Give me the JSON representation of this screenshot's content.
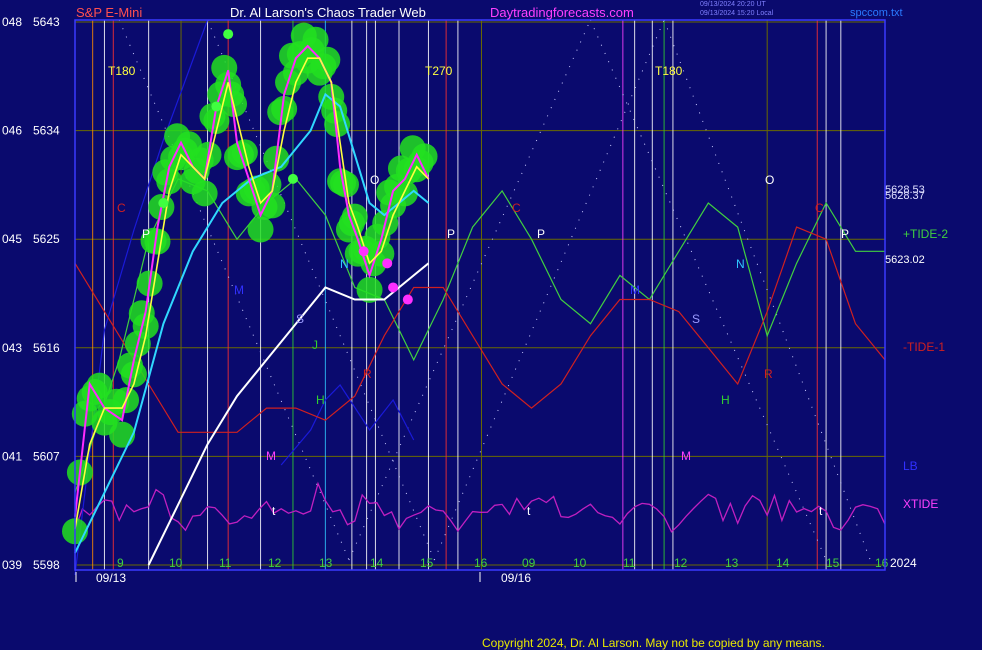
{
  "header": {
    "symbol": "S&P E-Mini",
    "site_title": "Dr. Al Larson's Chaos Trader Web",
    "site_url": "Daytradingforecasts.com",
    "stamp_line1": "09/13/2024 20:20 UT",
    "stamp_line2": "09/13/2024 15:20 Local",
    "file_name": "spccom.txt"
  },
  "footer": {
    "copyright": "Copyright 2024, Dr. Al Larson. May not be copied by any means."
  },
  "colors": {
    "background": "#0a0a6e",
    "grid": "#6a6a00",
    "frame": "#3a3aff",
    "price": "#ff2bff",
    "ema_fast": "#ffff40",
    "ema_mid": "#30d8ff",
    "ema_slow": "#ffffff",
    "halo": "#22e020",
    "tide_pos": "#40d040",
    "tide_neg": "#d02020",
    "lb": "#1a1ad8",
    "xtide": "#c020c0",
    "header_symbol": "#ff5050",
    "header_title": "#ffffff",
    "header_url": "#ff40ff"
  },
  "chart_data": {
    "type": "line",
    "title": "S&P E-Mini",
    "y_axis": {
      "ticks": [
        {
          "code": "039",
          "price": "5598"
        },
        {
          "code": "041",
          "price": "5607"
        },
        {
          "code": "043",
          "price": "5616"
        },
        {
          "code": "045",
          "price": "5625"
        },
        {
          "code": "046",
          "price": "5634"
        },
        {
          "code": "048",
          "price": "5643"
        }
      ],
      "ylim": [
        5598,
        5643
      ]
    },
    "x_axis": {
      "hour_ticks": [
        "9",
        "10",
        "11",
        "12",
        "13",
        "14",
        "15",
        "16",
        "09",
        "10",
        "11",
        "12",
        "13",
        "14",
        "15",
        "16"
      ],
      "dates": [
        "09/13",
        "09/16"
      ],
      "year": "2024"
    },
    "series": [
      {
        "name": "S&P E-Mini",
        "values": [
          [
            0,
            5602
          ],
          [
            0.5,
            5613
          ],
          [
            1,
            5611
          ],
          [
            1.6,
            5610
          ],
          [
            2,
            5615
          ],
          [
            2.4,
            5619
          ],
          [
            2.8,
            5626
          ],
          [
            3.2,
            5631
          ],
          [
            3.6,
            5633
          ],
          [
            4,
            5631
          ],
          [
            4.4,
            5630
          ],
          [
            4.8,
            5636
          ],
          [
            5.2,
            5639
          ],
          [
            5.5,
            5633
          ],
          [
            5.9,
            5630
          ],
          [
            6.3,
            5627
          ],
          [
            6.7,
            5629
          ],
          [
            7.1,
            5637
          ],
          [
            7.5,
            5640
          ],
          [
            7.9,
            5641
          ],
          [
            8.3,
            5640
          ],
          [
            8.7,
            5638
          ],
          [
            9.0,
            5631
          ],
          [
            9.3,
            5627
          ],
          [
            9.6,
            5625
          ],
          [
            10.0,
            5622
          ],
          [
            10.4,
            5625
          ],
          [
            10.8,
            5629
          ],
          [
            11.2,
            5630
          ],
          [
            11.6,
            5632
          ],
          [
            12.0,
            5630
          ]
        ]
      },
      {
        "name": "EMA fast",
        "values": [
          [
            0,
            5601
          ],
          [
            0.5,
            5608
          ],
          [
            1,
            5611
          ],
          [
            1.6,
            5611
          ],
          [
            2,
            5613
          ],
          [
            2.4,
            5617
          ],
          [
            2.8,
            5623
          ],
          [
            3.2,
            5629
          ],
          [
            3.6,
            5632
          ],
          [
            4,
            5631
          ],
          [
            4.4,
            5630
          ],
          [
            4.8,
            5634
          ],
          [
            5.2,
            5638
          ],
          [
            5.5,
            5635
          ],
          [
            5.9,
            5631
          ],
          [
            6.3,
            5628
          ],
          [
            6.7,
            5629
          ],
          [
            7.1,
            5634
          ],
          [
            7.5,
            5638
          ],
          [
            7.9,
            5640
          ],
          [
            8.3,
            5640
          ],
          [
            8.7,
            5638
          ],
          [
            9.0,
            5633
          ],
          [
            9.3,
            5628
          ],
          [
            9.6,
            5626
          ],
          [
            10.0,
            5623
          ],
          [
            10.4,
            5624
          ],
          [
            10.8,
            5627
          ],
          [
            11.2,
            5629
          ],
          [
            11.6,
            5631
          ],
          [
            12.0,
            5630
          ]
        ]
      },
      {
        "name": "EMA mid",
        "values": [
          [
            0,
            5599
          ],
          [
            1,
            5604
          ],
          [
            2,
            5609
          ],
          [
            3,
            5618
          ],
          [
            4,
            5624
          ],
          [
            5,
            5628
          ],
          [
            6,
            5630
          ],
          [
            7,
            5631
          ],
          [
            8,
            5634
          ],
          [
            8.5,
            5637
          ],
          [
            9,
            5636
          ],
          [
            9.5,
            5632
          ],
          [
            10,
            5628
          ],
          [
            10.5,
            5627
          ],
          [
            11,
            5628
          ],
          [
            11.5,
            5629
          ],
          [
            12,
            5628
          ]
        ]
      },
      {
        "name": "EMA slow",
        "values": [
          [
            2.5,
            5598
          ],
          [
            3.5,
            5603
          ],
          [
            4.5,
            5608
          ],
          [
            5.5,
            5612
          ],
          [
            6.5,
            5615
          ],
          [
            7.5,
            5618
          ],
          [
            8.5,
            5621
          ],
          [
            9.5,
            5620
          ],
          [
            10.5,
            5620
          ],
          [
            11.5,
            5622
          ],
          [
            12.0,
            5623
          ]
        ]
      },
      {
        "name": "+TIDE-2",
        "values": [
          [
            0,
            5604
          ],
          [
            1.5,
            5615
          ],
          [
            2.5,
            5625
          ],
          [
            3.5,
            5630
          ],
          [
            4.5,
            5629
          ],
          [
            5.5,
            5625
          ],
          [
            6.5,
            5628
          ],
          [
            7.5,
            5630
          ],
          [
            8.5,
            5627
          ],
          [
            9.5,
            5621
          ],
          [
            10.5,
            5620
          ],
          [
            11.5,
            5615
          ],
          [
            12.5,
            5620
          ],
          [
            13.5,
            5626
          ],
          [
            14.5,
            5629
          ],
          [
            15.5,
            5625
          ],
          [
            16.5,
            5620
          ],
          [
            17.5,
            5618
          ],
          [
            18.5,
            5622
          ],
          [
            19.5,
            5620
          ],
          [
            20.5,
            5624
          ],
          [
            21.5,
            5628
          ],
          [
            22.5,
            5626
          ],
          [
            23.5,
            5617
          ],
          [
            24.5,
            5623
          ],
          [
            25.5,
            5628
          ],
          [
            26.5,
            5624
          ],
          [
            27.5,
            5624
          ]
        ]
      },
      {
        "name": "-TIDE-1",
        "values": [
          [
            0,
            5623
          ],
          [
            1.5,
            5617
          ],
          [
            2.5,
            5613
          ],
          [
            3.5,
            5609
          ],
          [
            4.5,
            5609
          ],
          [
            5.5,
            5609
          ],
          [
            6.5,
            5611
          ],
          [
            7.5,
            5611
          ],
          [
            8.5,
            5610
          ],
          [
            9.5,
            5612
          ],
          [
            10.5,
            5617
          ],
          [
            11.5,
            5621
          ],
          [
            12.5,
            5621
          ],
          [
            13.5,
            5617
          ],
          [
            14.5,
            5613
          ],
          [
            15.5,
            5611
          ],
          [
            16.5,
            5613
          ],
          [
            17.5,
            5617
          ],
          [
            18.5,
            5620
          ],
          [
            19.5,
            5620
          ],
          [
            20.5,
            5619
          ],
          [
            21.5,
            5616
          ],
          [
            22.5,
            5613
          ],
          [
            23.5,
            5619
          ],
          [
            24.5,
            5626
          ],
          [
            25.5,
            5625
          ],
          [
            26.5,
            5618
          ],
          [
            27.5,
            5615
          ]
        ]
      }
    ],
    "price_labels": [
      "5628.53",
      "5628.37",
      "5623.02"
    ],
    "annotations": [
      {
        "text": "T180",
        "color": "#ffff40"
      },
      {
        "text": "T270",
        "color": "#ffff40"
      },
      {
        "text": "T180",
        "color": "#ffff40"
      },
      {
        "text": "C",
        "color": "#d02020"
      },
      {
        "text": "P",
        "color": "#ffffff"
      },
      {
        "text": "M",
        "color": "#3030ff"
      },
      {
        "text": "S",
        "color": "#9a9aff"
      },
      {
        "text": "J",
        "color": "#30d030"
      },
      {
        "text": "H",
        "color": "#30d030"
      },
      {
        "text": "M",
        "color": "#ff40ff"
      },
      {
        "text": "t",
        "color": "#ffffff"
      },
      {
        "text": "N",
        "color": "#30c8ff"
      },
      {
        "text": "O",
        "color": "#ffffff"
      },
      {
        "text": "R",
        "color": "#d02020"
      },
      {
        "text": "C",
        "color": "#d02020"
      },
      {
        "text": "P",
        "color": "#ffffff"
      },
      {
        "text": "P",
        "color": "#ffffff"
      },
      {
        "text": "t",
        "color": "#ffffff"
      },
      {
        "text": "M",
        "color": "#3030ff"
      },
      {
        "text": "S",
        "color": "#9a9aff"
      },
      {
        "text": "H",
        "color": "#30d030"
      },
      {
        "text": "M",
        "color": "#ff40ff"
      },
      {
        "text": "N",
        "color": "#30c8ff"
      },
      {
        "text": "O",
        "color": "#ffffff"
      },
      {
        "text": "R",
        "color": "#d02020"
      },
      {
        "text": "C",
        "color": "#d02020"
      },
      {
        "text": "P",
        "color": "#ffffff"
      },
      {
        "text": "t",
        "color": "#ffffff"
      }
    ],
    "legend": [
      {
        "label": "+TIDE-2",
        "color": "#40d040"
      },
      {
        "label": "-TIDE-1",
        "color": "#d02020"
      },
      {
        "label": "LB",
        "color": "#3030ff"
      },
      {
        "label": "XTIDE",
        "color": "#ff40ff"
      }
    ],
    "grid": true
  }
}
